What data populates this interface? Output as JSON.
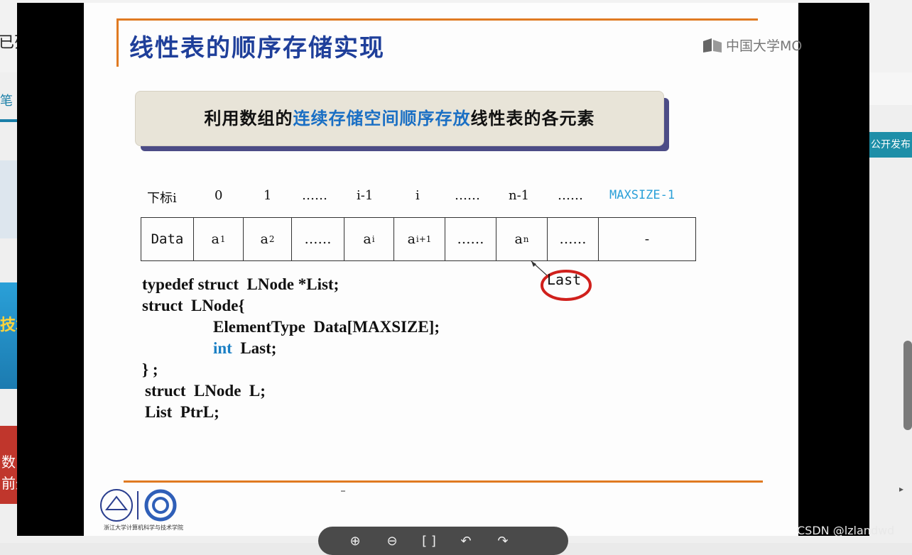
{
  "background": {
    "left_partial_text": "已列",
    "tab_partial": "笔",
    "blue_card_text": "技术",
    "red_card_lines": [
      "数",
      "前外"
    ],
    "right_button": "公开发布"
  },
  "slide": {
    "title": "线性表的顺序存储实现",
    "logo_text": "中国大学MO",
    "banner_before": "利用数组的",
    "banner_highlight": "连续存储空间顺序存放",
    "banner_after": "线性表的各元素",
    "index_labels": [
      "下标i",
      "0",
      "1",
      "……",
      "i-1",
      "i",
      "……",
      "n-1",
      "……",
      "MAXSIZE-1"
    ],
    "cells": [
      {
        "base": "Data",
        "sub": ""
      },
      {
        "base": "a",
        "sub": "1"
      },
      {
        "base": "a",
        "sub": "2"
      },
      {
        "base": "……",
        "sub": ""
      },
      {
        "base": "a",
        "sub": "i"
      },
      {
        "base": "a",
        "sub": "i+1"
      },
      {
        "base": "……",
        "sub": ""
      },
      {
        "base": "a",
        "sub": "n"
      },
      {
        "base": "……",
        "sub": ""
      },
      {
        "base": "-",
        "sub": ""
      }
    ],
    "last_label": "Last",
    "code": {
      "line1": "typedef struct  LNode *List;",
      "line2": "struct  LNode{",
      "line3": "ElementType  Data[MAXSIZE];",
      "line4_kw": "int",
      "line4_rest": "  Last;",
      "line5": "} ;",
      "line6": "struct  LNode  L;",
      "line7": "List  PtrL;"
    },
    "school_caption": "浙江大学计算机科学与技术学院"
  },
  "toolbar": {
    "icons": [
      "zoom-in-icon",
      "zoom-out-icon",
      "fit-screen-icon",
      "rotate-left-icon",
      "rotate-right-icon"
    ],
    "glyphs": [
      "⊕",
      "⊖",
      "[ ]",
      "↶",
      "↷"
    ]
  },
  "watermark": "CSDN @lzlandwd",
  "colors": {
    "title_blue": "#1f3f9a",
    "accent_orange": "#e07a22",
    "highlight_blue": "#1a6fc4",
    "circle_red": "#d0201c"
  }
}
